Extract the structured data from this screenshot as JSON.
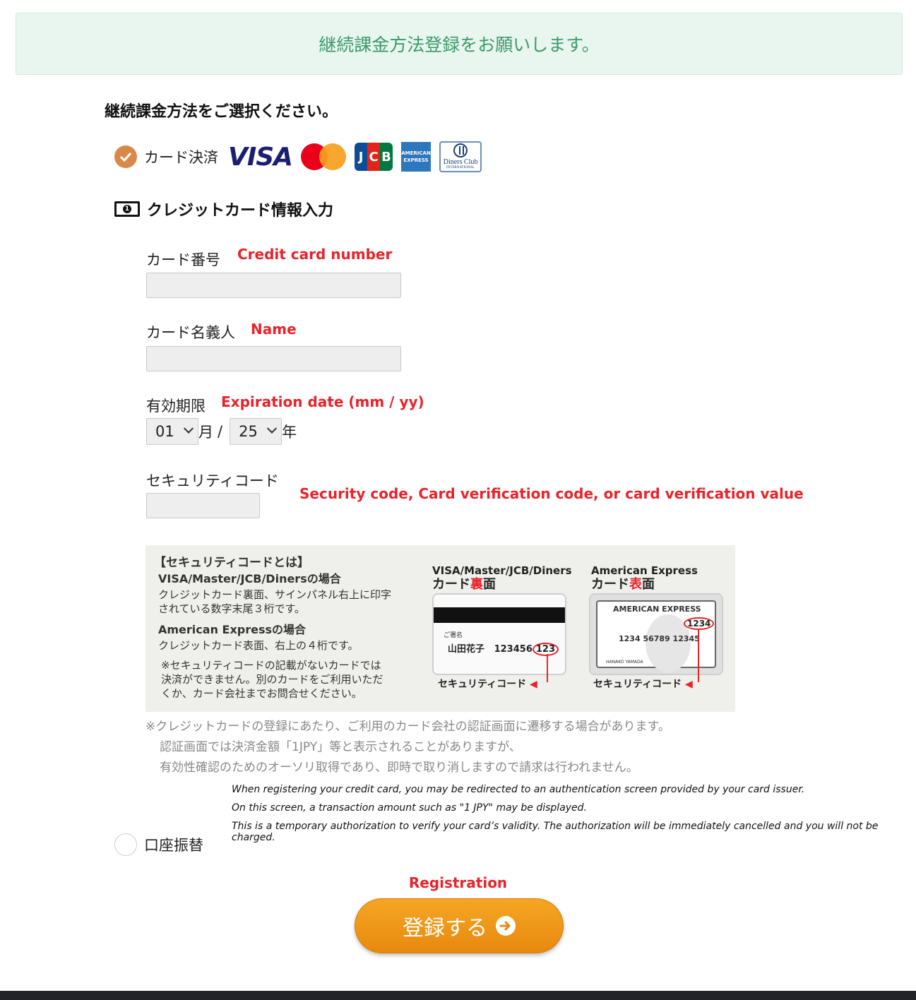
{
  "banner": {
    "text": "継続課金方法登録をお願いします。"
  },
  "section_title": "継続課金方法をご選択ください。",
  "payment_card": {
    "label": "カード決済",
    "selected": true,
    "brands": [
      "VISA",
      "Mastercard",
      "JCB",
      "American Express",
      "Diners Club"
    ],
    "visa_text": "VISA",
    "jcb_letters": [
      "J",
      "C",
      "B"
    ],
    "amex_lines": [
      "AMERICAN",
      "EXPRESS"
    ],
    "diners_lines": [
      "Diners Club",
      "INTERNATIONAL"
    ]
  },
  "card_info_heading": "クレジットカード情報入力",
  "fields": {
    "card_number": {
      "label": "カード番号",
      "annotation": "Credit card number",
      "value": ""
    },
    "card_name": {
      "label": "カード名義人",
      "annotation": "Name",
      "value": ""
    },
    "expiry": {
      "label": "有効期限",
      "annotation": "Expiration date (mm / yy)",
      "month": "01",
      "month_suffix": "月",
      "separator": "/",
      "year": "25",
      "year_suffix": "年"
    },
    "security_code": {
      "label": "セキュリティコード",
      "annotation": "Security code, Card verification code, or card verification value",
      "value": ""
    }
  },
  "security_info": {
    "title": "【セキュリティコードとは】",
    "visa_heading": "VISA/Master/JCB/Dinersの場合",
    "visa_text_1": "クレジットカード裏面、サインパネル右上に印字",
    "visa_text_2": "されている数字末尾３桁です。",
    "amex_heading": "American Expressの場合",
    "amex_text": "クレジットカード表面、右上の４桁です。",
    "note_1": "※セキュリティコードの記載がないカードでは",
    "note_2": "決済ができません。別のカードをご利用いただ",
    "note_3": "くか、カード会社までお問合せください。",
    "card_back_title": "VISA/Master/JCB/Diners",
    "card_back_sub_a": "カード",
    "card_back_sub_b": "裏",
    "card_back_sub_c": "面",
    "card_front_title": "American Express",
    "card_front_sub_a": "カード",
    "card_front_sub_b": "表",
    "card_front_sub_c": "面",
    "sig_label": "ご署名",
    "sig_name": "山田花子",
    "sig_number": "123456",
    "sig_code": "123",
    "amex_card_brand": "AMERICAN EXPRESS",
    "amex_code": "1234",
    "amex_number": "1234 56789 12345",
    "amex_holder": "HANAKO YAMADA",
    "caption": "セキュリティコード"
  },
  "notes_jp": [
    "※クレジットカードの登録にあたり、ご利用のカード会社の認証画面に遷移する場合があります。",
    "認証画面では決済金額「1JPY」等と表示されることがありますが、",
    "有効性確認のためのオーソリ取得であり、即時で取り消しますので請求は行われません。"
  ],
  "notes_en": [
    "When registering your credit card, you may be redirected to an authentication screen provided by your card issuer.",
    "On this screen, a transaction amount such as \"1 JPY\" may be displayed.",
    "This is a temporary authorization to verify your card’s validity. The authorization will be immediately cancelled and you will not be charged."
  ],
  "payment_bank": {
    "label": "口座振替",
    "selected": false
  },
  "registration": {
    "annotation": "Registration",
    "button_label": "登録する"
  },
  "colors": {
    "accent": "#d9884a",
    "button": "#f0961a",
    "annotation": "#e8232a",
    "banner_text": "#3a9a6a",
    "banner_bg": "#e9f5ef"
  }
}
